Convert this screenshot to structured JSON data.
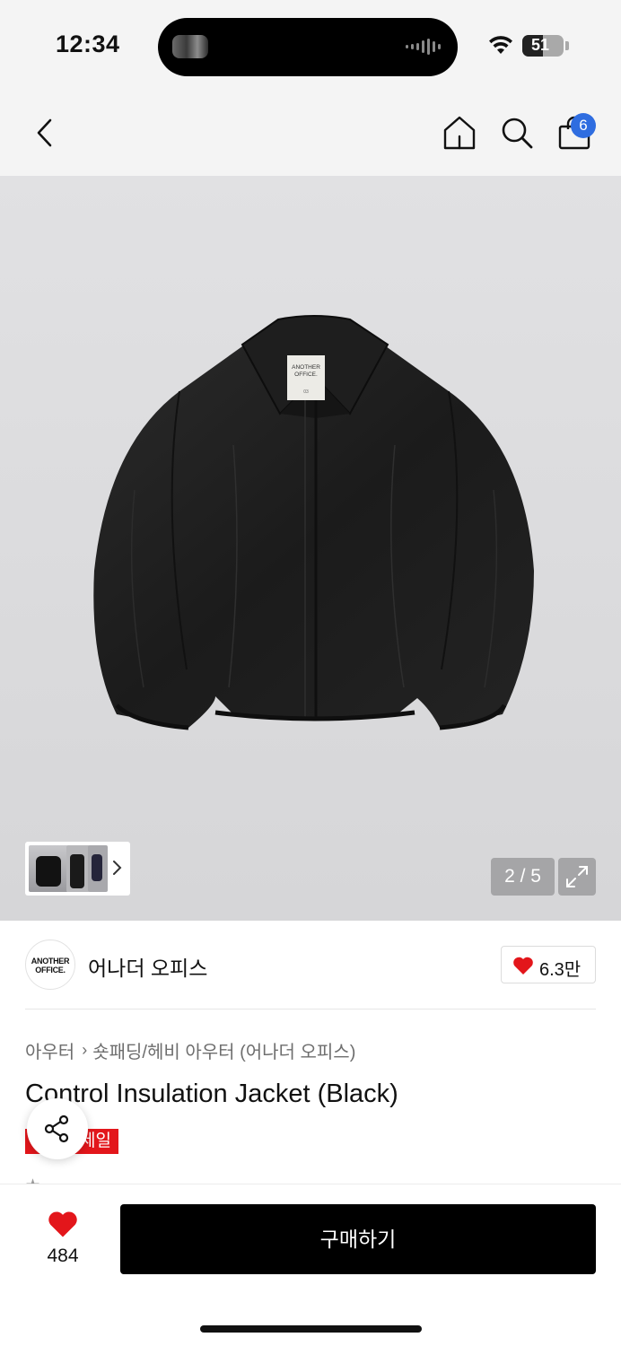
{
  "status_bar": {
    "time": "12:34",
    "battery": "51",
    "battery_level": 0.51
  },
  "header": {
    "back_icon": "chevron-left-icon",
    "home_icon": "home-icon",
    "search_icon": "search-icon",
    "cart_icon": "shopping-bag-icon",
    "cart_count": "6"
  },
  "gallery": {
    "counter": "2 / 5",
    "expand_icon": "expand-icon"
  },
  "brand": {
    "logo_line1": "ANOTHER",
    "logo_line2": "OFFICE.",
    "name": "어나더 오피스",
    "likes": "6.3만"
  },
  "breadcrumb": {
    "items": [
      "아우터",
      "숏패딩/헤비 아우터 (어나더 오피스)"
    ]
  },
  "product": {
    "title": "Control Insulation Jacket (Black)",
    "badge": "세일"
  },
  "bottom_bar": {
    "wish_count": "484",
    "buy_label": "구매하기"
  },
  "colors": {
    "accent_badge": "#2f6de0",
    "sale_red": "#e3161b",
    "heart_red": "#e3161b",
    "buy_bg": "#000000"
  }
}
